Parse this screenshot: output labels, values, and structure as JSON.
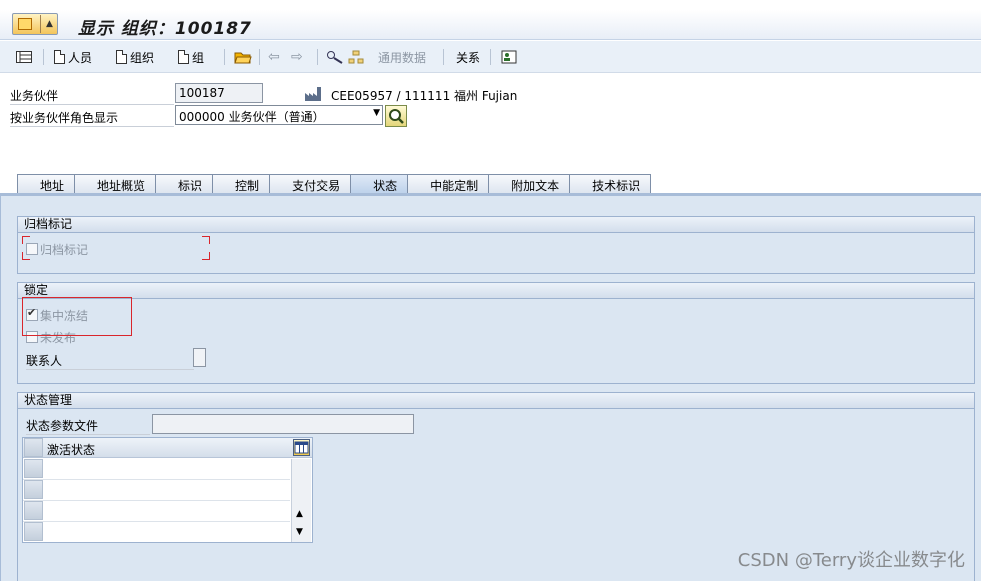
{
  "title": {
    "text": "显示 组织：100187"
  },
  "toolbar": {
    "person_label": "人员",
    "org_label": "组织",
    "group_label": "组",
    "general_data_label": "通用数据",
    "relationship_label": "关系"
  },
  "form": {
    "bp_label": "业务伙伴",
    "bp_value": "100187",
    "bp_desc": "CEE05957 / 111111 福州 Fujian",
    "role_label": "按业务伙伴角色显示",
    "role_value": "000000 业务伙伴（普通）"
  },
  "tabs": [
    {
      "label": "地址"
    },
    {
      "label": "地址概览"
    },
    {
      "label": "标识"
    },
    {
      "label": "控制"
    },
    {
      "label": "支付交易"
    },
    {
      "label": "状态"
    },
    {
      "label": "中能定制"
    },
    {
      "label": "附加文本"
    },
    {
      "label": "技术标识"
    }
  ],
  "active_tab": "状态",
  "archive": {
    "header": "归档标记",
    "checkbox_label": "归档标记",
    "checked": false
  },
  "lock": {
    "header": "锁定",
    "central_freeze_label": "集中冻结",
    "central_freeze_checked": true,
    "not_released_label": "未发布",
    "not_released_checked": false,
    "contact_label": "联系人"
  },
  "status_mgmt": {
    "header": "状态管理",
    "profile_label": "状态参数文件",
    "profile_value": "",
    "table_header": "激活状态",
    "rows": [
      "",
      "",
      "",
      ""
    ]
  },
  "watermark": "CSDN @Terry谈企业数字化",
  "colors": {
    "accent_red": "#d9262c",
    "panel_bg": "#dbe6f2"
  }
}
